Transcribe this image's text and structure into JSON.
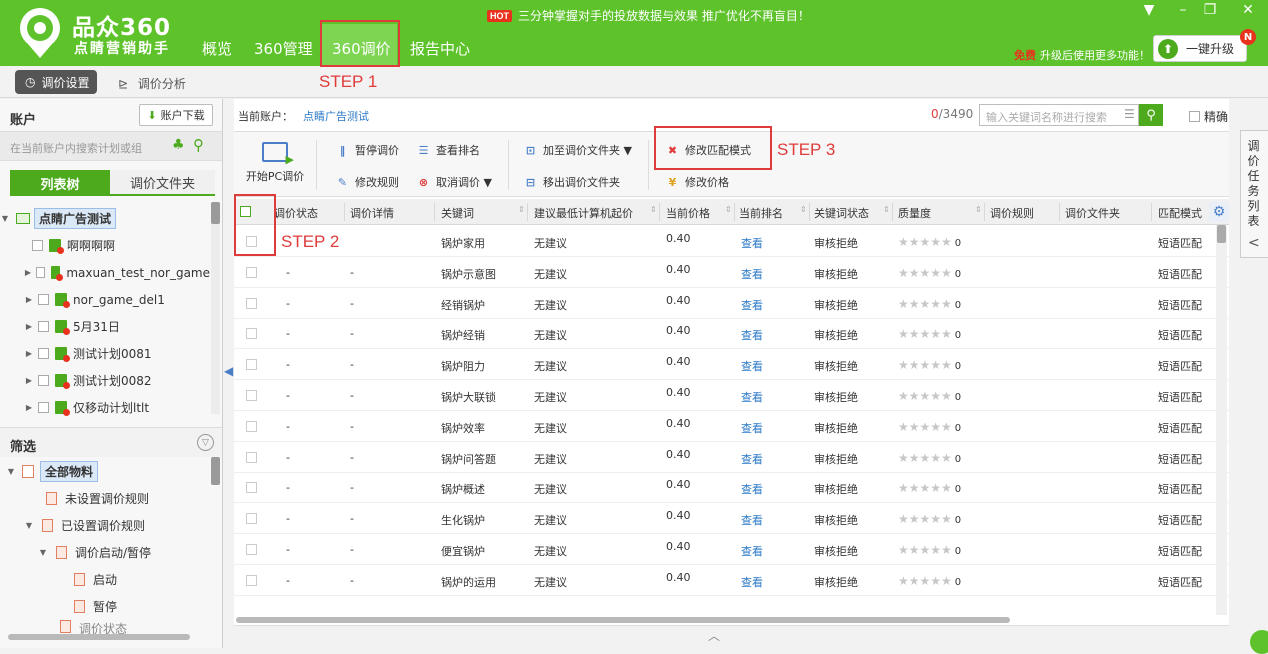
{
  "app": {
    "brand": "品众360",
    "brand_sub": "点睛营销助手",
    "nav": [
      "概览",
      "360管理",
      "360调价",
      "报告中心"
    ],
    "hot_badge": "HOT",
    "hot_text": "三分钟掌握对手的投放数据与效果 推广优化不再盲目！",
    "window_controls": [
      "▼",
      "–",
      "❐",
      "✕"
    ],
    "promo_free": "免费",
    "promo_text": "升级后使用更多功能！",
    "upgrade_label": "一键升级",
    "upgrade_badge": "N"
  },
  "subtabs": {
    "active": "调价设置",
    "other": "调价分析"
  },
  "annotations": {
    "step1": "STEP 1",
    "step2": "STEP 2",
    "step3": "STEP 3",
    "color": "#e03b3b"
  },
  "left": {
    "account_title": "账户",
    "download_label": "账户下载",
    "search_placeholder": "在当前账户内搜索计划或组",
    "tab_list": "列表树",
    "tab_folder": "调价文件夹",
    "root": "点睛广告测试",
    "plans": [
      "啊啊啊啊",
      "maxuan_test_nor_game",
      "nor_game_del1",
      "5月31日",
      "测试计划0081",
      "测试计划0082",
      "仅移动计划ltlt"
    ],
    "filter_title": "筛选",
    "filter_root": "全部物料",
    "filter_items": [
      "未设置调价规则",
      "已设置调价规则",
      "调价启动/暂停",
      "启动",
      "暂停",
      "调价状态"
    ]
  },
  "main": {
    "current_account_label": "当前账户：",
    "current_account_value": "点睛广告测试",
    "count_selected": "0",
    "count_total": "/3490",
    "search_placeholder": "输入关键词名称进行搜索",
    "exact_label": "精确",
    "toolbar": {
      "start_pc": "开始PC调价",
      "pause": "暂停调价",
      "view_rank": "查看排名",
      "add_folder": "加至调价文件夹 ▼",
      "modify_match": "修改匹配模式",
      "modify_rule": "修改规则",
      "cancel": "取消调价 ▼",
      "remove_folder": "移出调价文件夹",
      "modify_price": "修改价格"
    },
    "columns": [
      "调价状态",
      "调价详情",
      "关键词",
      "建议最低计算机起价",
      "当前价格",
      "当前排名",
      "关键词状态",
      "质量度",
      "调价规则",
      "调价文件夹",
      "匹配模式"
    ],
    "rows": [
      {
        "status": "",
        "detail": "",
        "keyword": "锅炉家用",
        "suggest": "无建议",
        "price": "0.40",
        "rank": "查看",
        "kw_status": "审核拒绝",
        "quality": "0",
        "rule": "",
        "folder": "",
        "match": "短语匹配"
      },
      {
        "status": "-",
        "detail": "-",
        "keyword": "锅炉示意图",
        "suggest": "无建议",
        "price": "0.40",
        "rank": "查看",
        "kw_status": "审核拒绝",
        "quality": "0",
        "rule": "",
        "folder": "",
        "match": "短语匹配"
      },
      {
        "status": "-",
        "detail": "-",
        "keyword": "经销锅炉",
        "suggest": "无建议",
        "price": "0.40",
        "rank": "查看",
        "kw_status": "审核拒绝",
        "quality": "0",
        "rule": "",
        "folder": "",
        "match": "短语匹配"
      },
      {
        "status": "-",
        "detail": "-",
        "keyword": "锅炉经销",
        "suggest": "无建议",
        "price": "0.40",
        "rank": "查看",
        "kw_status": "审核拒绝",
        "quality": "0",
        "rule": "",
        "folder": "",
        "match": "短语匹配"
      },
      {
        "status": "-",
        "detail": "-",
        "keyword": "锅炉阻力",
        "suggest": "无建议",
        "price": "0.40",
        "rank": "查看",
        "kw_status": "审核拒绝",
        "quality": "0",
        "rule": "",
        "folder": "",
        "match": "短语匹配"
      },
      {
        "status": "-",
        "detail": "-",
        "keyword": "锅炉大联锁",
        "suggest": "无建议",
        "price": "0.40",
        "rank": "查看",
        "kw_status": "审核拒绝",
        "quality": "0",
        "rule": "",
        "folder": "",
        "match": "短语匹配"
      },
      {
        "status": "-",
        "detail": "-",
        "keyword": "锅炉效率",
        "suggest": "无建议",
        "price": "0.40",
        "rank": "查看",
        "kw_status": "审核拒绝",
        "quality": "0",
        "rule": "",
        "folder": "",
        "match": "短语匹配"
      },
      {
        "status": "-",
        "detail": "-",
        "keyword": "锅炉问答题",
        "suggest": "无建议",
        "price": "0.40",
        "rank": "查看",
        "kw_status": "审核拒绝",
        "quality": "0",
        "rule": "",
        "folder": "",
        "match": "短语匹配"
      },
      {
        "status": "-",
        "detail": "-",
        "keyword": "锅炉概述",
        "suggest": "无建议",
        "price": "0.40",
        "rank": "查看",
        "kw_status": "审核拒绝",
        "quality": "0",
        "rule": "",
        "folder": "",
        "match": "短语匹配"
      },
      {
        "status": "-",
        "detail": "-",
        "keyword": "生化锅炉",
        "suggest": "无建议",
        "price": "0.40",
        "rank": "查看",
        "kw_status": "审核拒绝",
        "quality": "0",
        "rule": "",
        "folder": "",
        "match": "短语匹配"
      },
      {
        "status": "-",
        "detail": "-",
        "keyword": "便宜锅炉",
        "suggest": "无建议",
        "price": "0.40",
        "rank": "查看",
        "kw_status": "审核拒绝",
        "quality": "0",
        "rule": "",
        "folder": "",
        "match": "短语匹配"
      },
      {
        "status": "-",
        "detail": "-",
        "keyword": "锅炉的运用",
        "suggest": "无建议",
        "price": "0.40",
        "rank": "查看",
        "kw_status": "审核拒绝",
        "quality": "0",
        "rule": "",
        "folder": "",
        "match": "短语匹配"
      }
    ]
  },
  "right_panel": {
    "label": "调价任务列表",
    "arrow": "<"
  },
  "colors": {
    "header_green": "#5ec22b",
    "accent_green": "#4caa1c",
    "link_blue": "#2a78c6",
    "alert_red": "#e03b3b"
  }
}
